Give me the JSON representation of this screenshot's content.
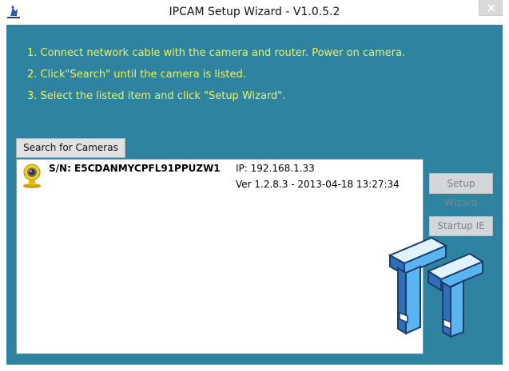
{
  "window": {
    "title": "IPCAM Setup Wizard - V1.0.5.2",
    "icon": "app-icon",
    "close_icon": "close-icon"
  },
  "instructions": [
    "1. Connect network cable with the camera and router. Power on camera.",
    "2. Click\"Search\" until the camera is listed.",
    "3. Select the listed item and click \"Setup Wizard\"."
  ],
  "buttons": {
    "search": "Search for Cameras",
    "setup_wizard": "Setup Wizard",
    "startup_ie": "Startup IE"
  },
  "camera_list": [
    {
      "icon": "camera-icon",
      "sn": "S/N: E5CDANMYCPFL91PPUZW1",
      "ip": "IP: 192.168.1.33",
      "version": "Ver 1.2.8.3 - 2013-04-18 13:27:34"
    }
  ],
  "watermark": {
    "name": "tt-logo"
  },
  "colors": {
    "client_background": "#2e83a0",
    "instruction_text": "#ecf25a",
    "list_background": "#ffffff"
  }
}
